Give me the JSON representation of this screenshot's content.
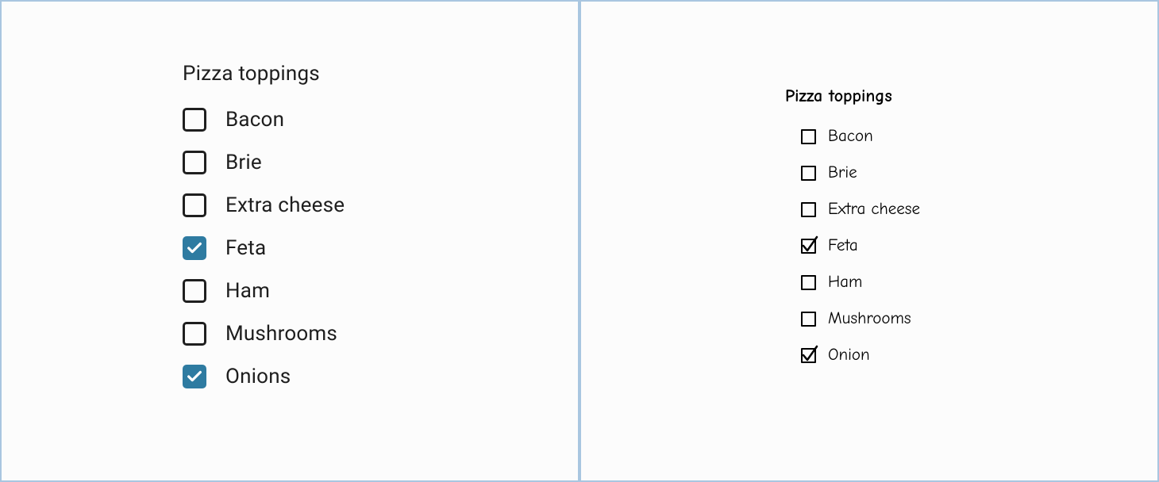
{
  "left": {
    "heading": "Pizza toppings",
    "items": [
      {
        "label": "Bacon",
        "checked": false
      },
      {
        "label": "Brie",
        "checked": false
      },
      {
        "label": "Extra cheese",
        "checked": false
      },
      {
        "label": "Feta",
        "checked": true
      },
      {
        "label": "Ham",
        "checked": false
      },
      {
        "label": "Mushrooms",
        "checked": false
      },
      {
        "label": "Onions",
        "checked": true
      }
    ]
  },
  "right": {
    "heading": "Pizza toppings",
    "items": [
      {
        "label": "Bacon",
        "checked": false
      },
      {
        "label": "Brie",
        "checked": false
      },
      {
        "label": "Extra cheese",
        "checked": false
      },
      {
        "label": "Feta",
        "checked": true
      },
      {
        "label": "Ham",
        "checked": false
      },
      {
        "label": "Mushrooms",
        "checked": false
      },
      {
        "label": "Onion",
        "checked": true
      }
    ]
  }
}
